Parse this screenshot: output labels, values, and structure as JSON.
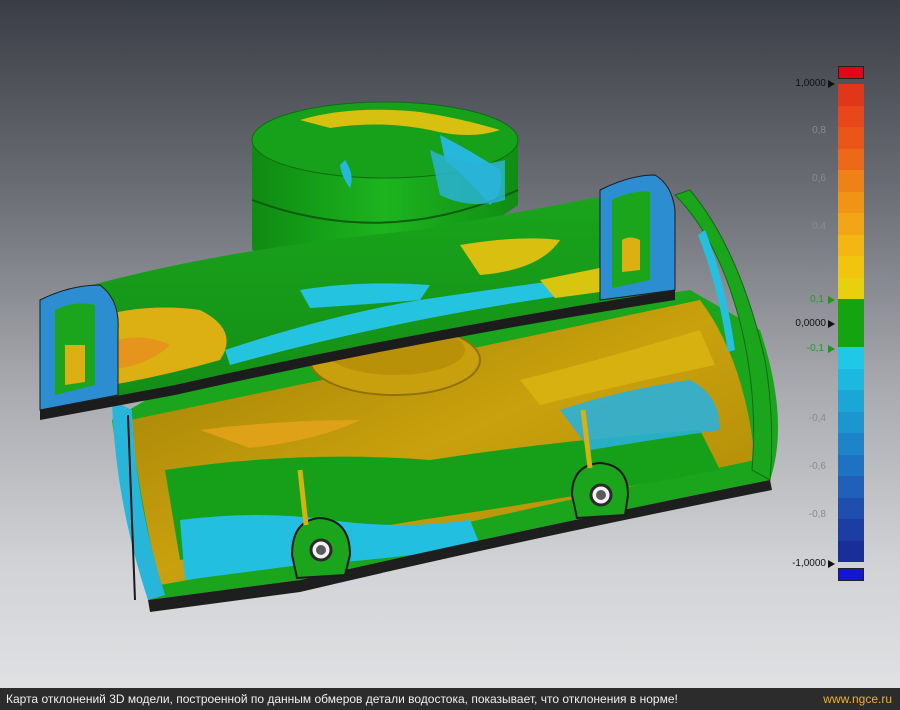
{
  "caption": {
    "text": "Карта отклонений 3D модели, построенной по данным обмеров детали водостока, показывает, что отклонения в норме!",
    "site": "www.ngce.ru"
  },
  "scale": {
    "labels": [
      {
        "text": "1,0000",
        "style": "strong",
        "marker": "black"
      },
      {
        "text": "0,8",
        "style": "muted"
      },
      {
        "text": "0,6",
        "style": "muted"
      },
      {
        "text": "0,4",
        "style": "muted"
      },
      {
        "text": "0,2",
        "style": "muted"
      },
      {
        "text": "0,1",
        "style": "green",
        "marker": "green"
      },
      {
        "text": "0,0000",
        "style": "strong",
        "marker": "black"
      },
      {
        "text": "-0,1",
        "style": "green",
        "marker": "green"
      },
      {
        "text": "-0,4",
        "style": "muted"
      },
      {
        "text": "-0,6",
        "style": "muted"
      },
      {
        "text": "-0,8",
        "style": "muted"
      },
      {
        "text": "-1,0000",
        "style": "strong",
        "marker": "black"
      }
    ],
    "overflow_color": "#e3061b",
    "underflow_color": "#1316d6",
    "tolerance_color": "#13a40f",
    "positive_colors": [
      "#e2361a",
      "#e9461b",
      "#ea5619",
      "#ec6a17",
      "#ef8216",
      "#f19416",
      "#f3a615",
      "#f4b613",
      "#f1c40f",
      "#e9d00f"
    ],
    "negative_colors": [
      "#1ec8e6",
      "#1bb8e0",
      "#1aa7d8",
      "#1b96d1",
      "#1d84c9",
      "#1f72c1",
      "#2060b8",
      "#1f4fae",
      "#1c3ea4",
      "#192e99"
    ]
  },
  "model": {
    "colors": {
      "green": "#17a51b",
      "green_dark": "#0f7d13",
      "cyan": "#23c3de",
      "blue": "#2878c8",
      "yellow": "#d9b20f",
      "orange": "#e8a318",
      "edge": "#1b1b1b"
    }
  }
}
